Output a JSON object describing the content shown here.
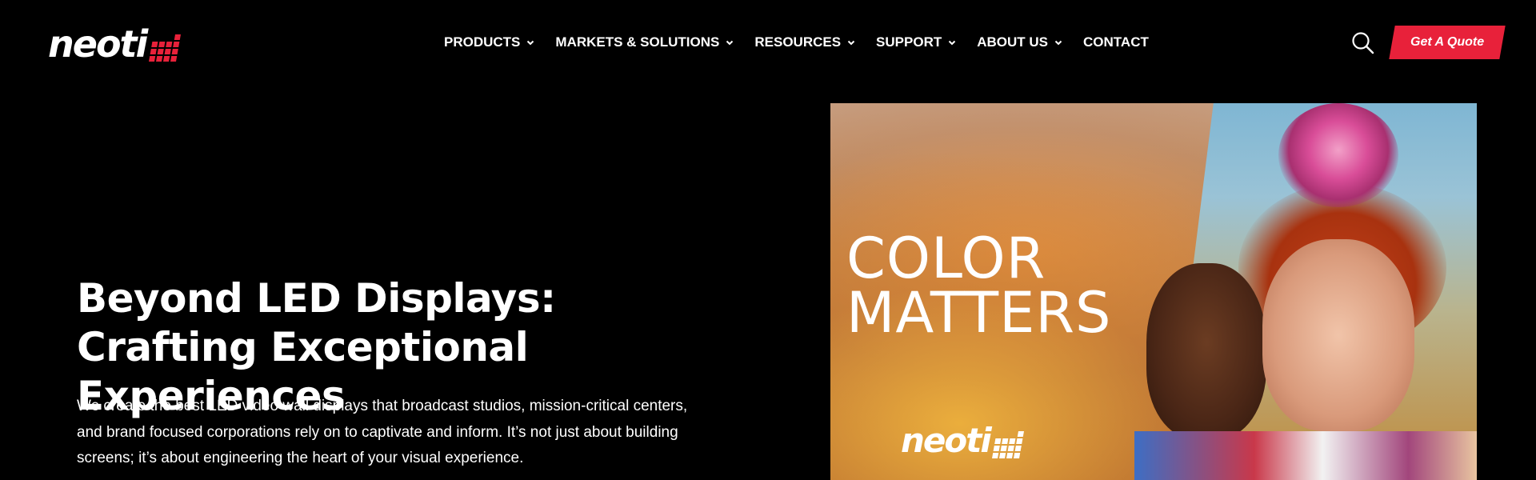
{
  "brand": {
    "name": "neoti",
    "accent_color": "#e8213a"
  },
  "nav": {
    "items": [
      {
        "label": "PRODUCTS",
        "has_dropdown": true
      },
      {
        "label": "MARKETS & SOLUTIONS",
        "has_dropdown": true
      },
      {
        "label": "RESOURCES",
        "has_dropdown": true
      },
      {
        "label": "SUPPORT",
        "has_dropdown": true
      },
      {
        "label": "ABOUT US",
        "has_dropdown": true
      },
      {
        "label": "CONTACT",
        "has_dropdown": false
      }
    ],
    "search_icon": "search-icon",
    "quote_label": "Get A Quote"
  },
  "hero": {
    "title": "Beyond LED Displays: Crafting Exceptional Experiences",
    "description": "We create the best LED video wall displays that broadcast studios, mission-critical centers, and brand focused corporations rely on to captivate and inform. It’s not just about building screens; it’s about engineering the heart of your visual experience.",
    "image": {
      "headline": "COLOR MATTERS",
      "logo_text": "neoti"
    }
  }
}
